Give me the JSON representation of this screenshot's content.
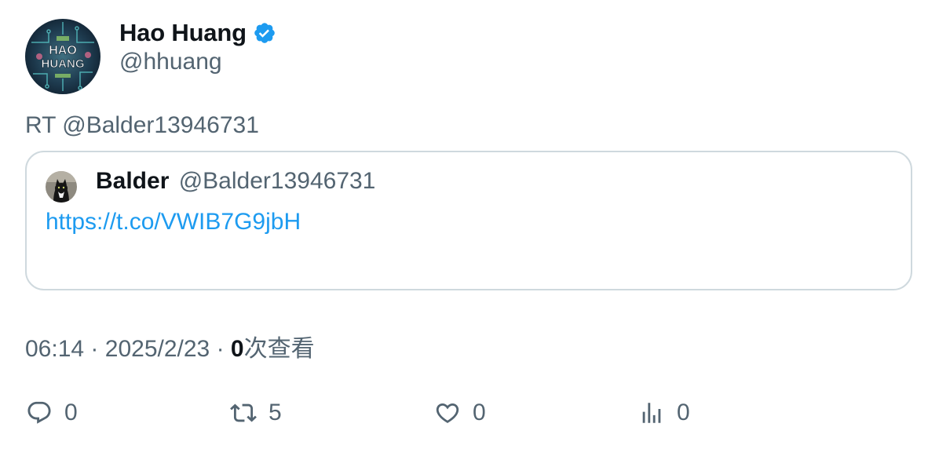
{
  "author": {
    "name": "Hao Huang",
    "handle": "@hhuang",
    "avatar_text_line1": "HAO",
    "avatar_text_line2": "HUANG",
    "verified_icon": "verified-badge-icon"
  },
  "tweet": {
    "text": "RT @Balder13946731"
  },
  "quote": {
    "name": "Balder",
    "handle": "@Balder13946731",
    "link": "https://t.co/VWIB7G9jbH"
  },
  "meta": {
    "time": "06:14",
    "separator": "·",
    "date": "2025/2/23",
    "views_count": "0",
    "views_label": "次查看"
  },
  "actions": {
    "reply": {
      "icon": "reply-icon",
      "count": "0"
    },
    "retweet": {
      "icon": "retweet-icon",
      "count": "5"
    },
    "like": {
      "icon": "heart-icon",
      "count": "0"
    },
    "views": {
      "icon": "analytics-icon",
      "count": "0"
    }
  },
  "colors": {
    "text_primary": "#0f1419",
    "text_secondary": "#536471",
    "link": "#1d9bf0",
    "border": "#cfd9de",
    "verified": "#1d9bf0"
  }
}
